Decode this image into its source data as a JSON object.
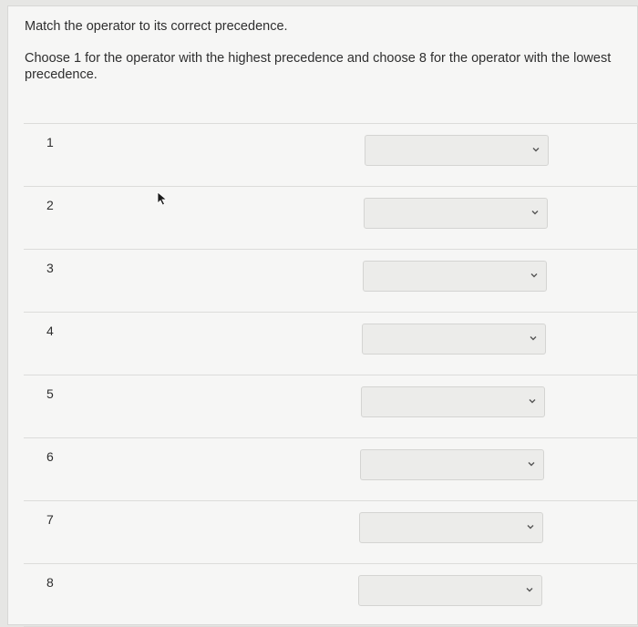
{
  "question": {
    "title": "Match the operator to its correct precedence.",
    "instructions": "Choose 1 for the operator with the highest precedence and choose 8 for the operator with the lowest precedence."
  },
  "rows": [
    {
      "number": "1",
      "selected": ""
    },
    {
      "number": "2",
      "selected": ""
    },
    {
      "number": "3",
      "selected": ""
    },
    {
      "number": "4",
      "selected": ""
    },
    {
      "number": "5",
      "selected": ""
    },
    {
      "number": "6",
      "selected": ""
    },
    {
      "number": "7",
      "selected": ""
    },
    {
      "number": "8",
      "selected": ""
    }
  ],
  "icons": {
    "dropdown": "chevron-down-icon",
    "cursor": "mouse-pointer-icon"
  },
  "colors": {
    "background": "#e6e6e4",
    "card": "#f6f6f5",
    "select": "#ececea"
  }
}
